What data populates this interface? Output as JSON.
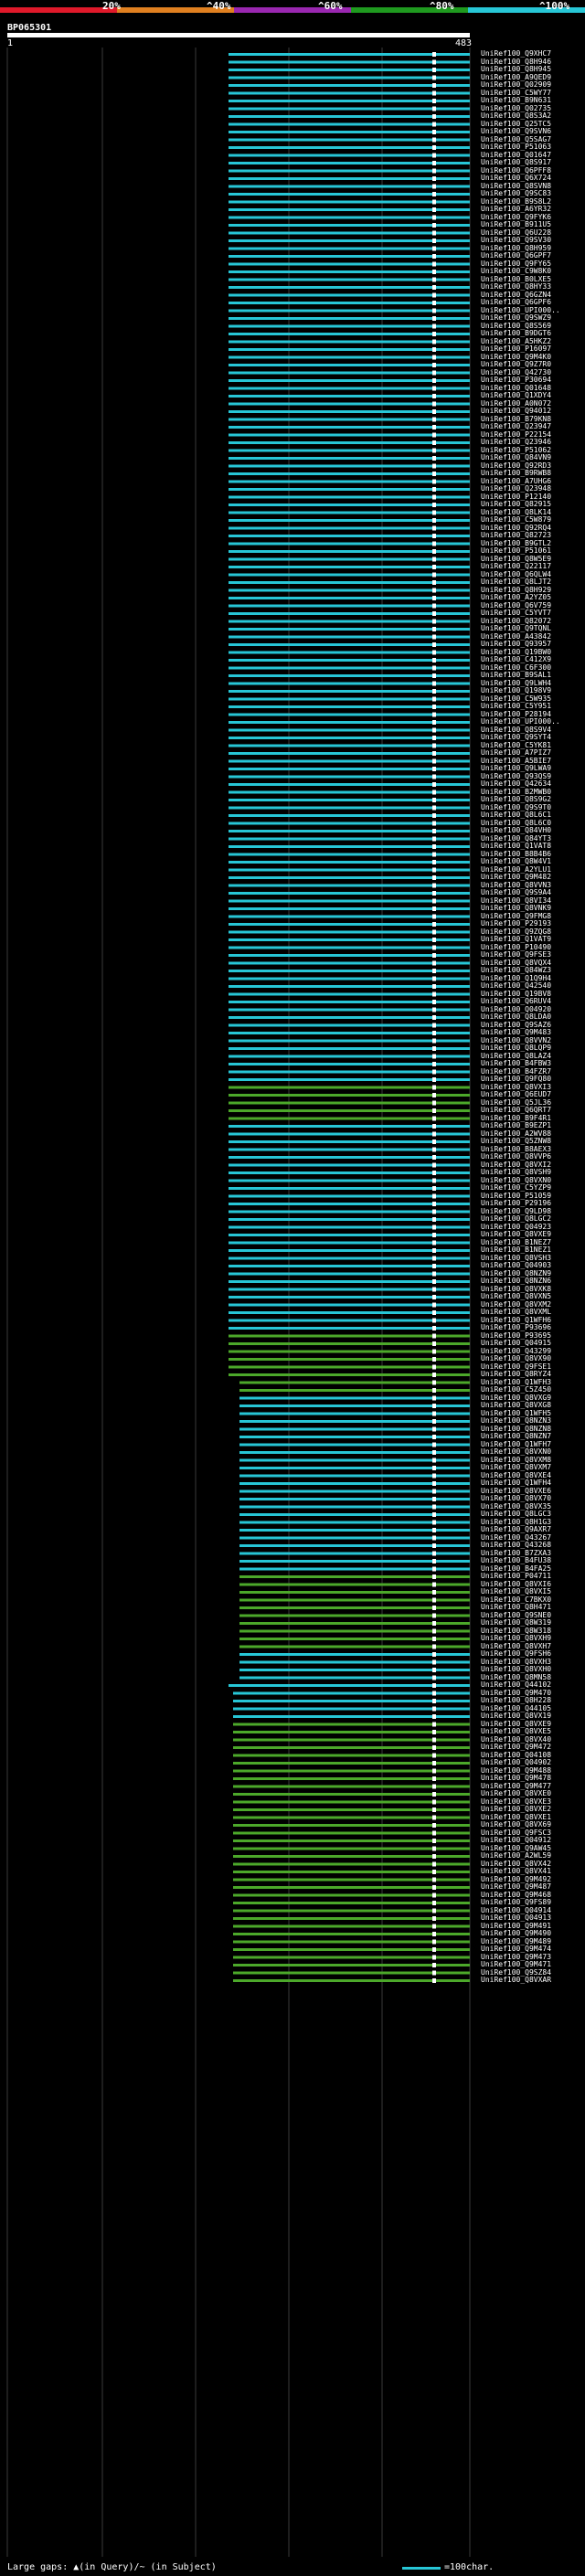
{
  "colors": {
    "scale": [
      "#e0192a",
      "#e08020",
      "#9a27b0",
      "#1f9a1f",
      "#27c6d6"
    ],
    "hit_cyan": "#27c6d6",
    "hit_green": "#4ca82a",
    "query_bar": "#ffffff",
    "gridline": "#3a3a3a"
  },
  "scale": {
    "labels": [
      "20%",
      "^40%",
      "^60%",
      "^80%",
      "^100%"
    ]
  },
  "query": {
    "name": "BP065301",
    "start": "1",
    "end": "483"
  },
  "footer": {
    "legend_text": "Large gaps: ▲(in Query)/~ (in Subject)",
    "scale_text": "=100char."
  },
  "hits": [
    "UniRef100_Q9XHC7",
    "UniRef100_Q8H946",
    "UniRef100_Q8H945",
    "UniRef100_A9QED9",
    "UniRef100_Q02909",
    "UniRef100_C5WY77",
    "UniRef100_B9N631",
    "UniRef100_Q02735",
    "UniRef100_Q8S3A2",
    "UniRef100_Q25TC5",
    "UniRef100_Q9SVN6",
    "UniRef100_Q5SAG7",
    "UniRef100_P51063",
    "UniRef100_Q01647",
    "UniRef100_Q8S917",
    "UniRef100_Q6PFF8",
    "UniRef100_Q6X724",
    "UniRef100_Q8SVN8",
    "UniRef100_Q9SC83",
    "UniRef100_B9S8L2",
    "UniRef100_A6YR32",
    "UniRef100_Q9FYK6",
    "UniRef100_B911U5",
    "UniRef100_Q6U228",
    "UniRef100_Q9SV30",
    "UniRef100_Q8H959",
    "UniRef100_Q6GPF7",
    "UniRef100_Q9FY65",
    "UniRef100_C9W8K0",
    "UniRef100_B0LXE5",
    "UniRef100_Q8HY33",
    "UniRef100_Q6GZN4",
    "UniRef100_Q6GPF6",
    "UniRef100_UPI000..",
    "UniRef100_Q9SWZ9",
    "UniRef100_Q8S569",
    "UniRef100_B9DGT6",
    "UniRef100_A5HKZ2",
    "UniRef100_P16097",
    "UniRef100_Q9M4K0",
    "UniRef100_Q9Z7R0",
    "UniRef100_Q42730",
    "UniRef100_P30694",
    "UniRef100_Q01648",
    "UniRef100_Q1XDY4",
    "UniRef100_A0N072",
    "UniRef100_Q94012",
    "UniRef100_B79KN8",
    "UniRef100_Q23947",
    "UniRef100_P22154",
    "UniRef100_Q23946",
    "UniRef100_P51062",
    "UniRef100_Q84VN9",
    "UniRef100_Q92RD3",
    "UniRef100_B9RWB8",
    "UniRef100_A7UHG6",
    "UniRef100_Q23948",
    "UniRef100_P12140",
    "UniRef100_Q82915",
    "UniRef100_Q8LK14",
    "UniRef100_C5W879",
    "UniRef100_Q92RQ4",
    "UniRef100_Q82723",
    "UniRef100_B9GTL2",
    "UniRef100_P51061",
    "UniRef100_Q8W5E9",
    "UniRef100_Q22117",
    "UniRef100_Q6QLW4",
    "UniRef100_Q8LJT2",
    "UniRef100_Q8H929",
    "UniRef100_A2YZ05",
    "UniRef100_Q6V759",
    "UniRef100_C5YVT7",
    "UniRef100_Q82072",
    "UniRef100_Q9TQNL",
    "UniRef100_A43842",
    "UniRef100_Q93957",
    "UniRef100_Q19BW0",
    "UniRef100_C412X9",
    "UniRef100_C6F300",
    "UniRef100_B9SAL1",
    "UniRef100_Q9LWH4",
    "UniRef100_Q198V9",
    "UniRef100_C5W935",
    "UniRef100_C5Y951",
    "UniRef100_P28194",
    "UniRef100_UPI000..",
    "UniRef100_Q8S9V4",
    "UniRef100_Q9SYT4",
    "UniRef100_C5YK81",
    "UniRef100_A7PIZ7",
    "UniRef100_A5BIE7",
    "UniRef100_Q9LWA9",
    "UniRef100_Q93QS9",
    "UniRef100_Q42634",
    "UniRef100_B2MWB0",
    "UniRef100_Q8S9G2",
    "UniRef100_Q9S9T0",
    "UniRef100_Q8L6C1",
    "UniRef100_Q8L6C0",
    "UniRef100_Q84VH0",
    "UniRef100_Q84YT3",
    "UniRef100_Q1VAT8",
    "UniRef100_B8B4B6",
    "UniRef100_Q8W4V1",
    "UniRef100_A2YLU1",
    "UniRef100_Q9M482",
    "UniRef100_Q8VVN3",
    "UniRef100_Q9S9A4",
    "UniRef100_Q8VI34",
    "UniRef100_Q8VNK9",
    "UniRef100_Q9FMG8",
    "UniRef100_P29193",
    "UniRef100_Q9ZQG8",
    "UniRef100_Q1VAT9",
    "UniRef100_P10490",
    "UniRef100_Q9FSE3",
    "UniRef100_Q8VQX4",
    "UniRef100_Q84WZ3",
    "UniRef100_Q1Q9H4",
    "UniRef100_Q42540",
    "UniRef100_Q19BV8",
    "UniRef100_Q6RUV4",
    "UniRef100_Q04920",
    "UniRef100_Q8LDA0",
    "UniRef100_Q9SAZ6",
    "UniRef100_Q9M483",
    "UniRef100_Q8VVN2",
    "UniRef100_Q8LQP9",
    "UniRef100_Q8LAZ4",
    "UniRef100_B4FBW3",
    "UniRef100_B4FZR7",
    "UniRef100_Q9FQ80",
    "UniRef100_Q8VXI3",
    "UniRef100_Q6EUD7",
    "UniRef100_Q5JL36",
    "UniRef100_Q6QRT7",
    "UniRef100_B9F4R1",
    "UniRef100_B9EZP1",
    "UniRef100_A2WV88",
    "UniRef100_Q5ZNW8",
    "UniRef100_B8AEX3",
    "UniRef100_Q8VVP6",
    "UniRef100_Q8VXI2",
    "UniRef100_Q8VSH9",
    "UniRef100_Q8VXN0",
    "UniRef100_C5YZP9",
    "UniRef100_P51059",
    "UniRef100_P29196",
    "UniRef100_Q9LD98",
    "UniRef100_Q8LGC2",
    "UniRef100_Q04923",
    "UniRef100_Q8VXE9",
    "UniRef100_B1NEZ7",
    "UniRef100_B1NEZ1",
    "UniRef100_Q8VSH3",
    "UniRef100_Q04903",
    "UniRef100_Q8NZN9",
    "UniRef100_Q8NZN6",
    "UniRef100_Q8VXK8",
    "UniRef100_Q8VXN5",
    "UniRef100_Q8VXM2",
    "UniRef100_Q8VXML",
    "UniRef100_Q1WFH6",
    "UniRef100_P93696",
    "UniRef100_P93695",
    "UniRef100_Q04915",
    "UniRef100_Q43299",
    "UniRef100_Q8VX90",
    "UniRef100_Q9FSE1",
    "UniRef100_Q8RYZ4",
    "UniRef100_Q1WFH3",
    "UniRef100_C5Z450",
    "UniRef100_Q8VXG9",
    "UniRef100_Q8VXG8",
    "UniRef100_Q1WFH5",
    "UniRef100_Q8NZN3",
    "UniRef100_Q8NZN8",
    "UniRef100_Q8NZN7",
    "UniRef100_Q1WFH7",
    "UniRef100_Q8VXN0",
    "UniRef100_Q8VXM8",
    "UniRef100_Q8VXM7",
    "UniRef100_Q8VXE4",
    "UniRef100_Q1WFH4",
    "UniRef100_Q8VXE6",
    "UniRef100_Q8VX70",
    "UniRef100_Q8VX35",
    "UniRef100_Q8LGC3",
    "UniRef100_Q8H1G3",
    "UniRef100_Q9AXR7",
    "UniRef100_Q43267",
    "UniRef100_Q43268",
    "UniRef100_B7ZXA3",
    "UniRef100_B4FU38",
    "UniRef100_B4FA25",
    "UniRef100_P04711",
    "UniRef100_Q8VXI6",
    "UniRef100_Q8VXI5",
    "UniRef100_C7BKX0",
    "UniRef100_Q8H471",
    "UniRef100_Q9SNE0",
    "UniRef100_Q8W319",
    "UniRef100_Q8W318",
    "UniRef100_Q8VXH9",
    "UniRef100_Q8VXH7",
    "UniRef100_Q9FSH6",
    "UniRef100_Q8VXH3",
    "UniRef100_Q8VXH0",
    "UniRef100_Q8MN58",
    "UniRef100_Q44102",
    "UniRef100_Q9M470",
    "UniRef100_Q8H228",
    "UniRef100_Q44105",
    "UniRef100_Q8VX19",
    "UniRef100_Q8VXE9",
    "UniRef100_Q8VXE5",
    "UniRef100_Q8VX40",
    "UniRef100_Q9M472",
    "UniRef100_Q04108",
    "UniRef100_Q04902",
    "UniRef100_Q9M488",
    "UniRef100_Q9M478",
    "UniRef100_Q9M477",
    "UniRef100_Q8VXE0",
    "UniRef100_Q8VXE3",
    "UniRef100_Q8VXE2",
    "UniRef100_Q8VXE1",
    "UniRef100_Q8VX69",
    "UniRef100_Q9FSC3",
    "UniRef100_Q04912",
    "UniRef100_Q9AW45",
    "UniRef100_A2WL59",
    "UniRef100_Q8VX42",
    "UniRef100_Q8VX41",
    "UniRef100_Q9M492",
    "UniRef100_Q9M487",
    "UniRef100_Q9M468",
    "UniRef100_Q9FS89",
    "UniRef100_Q04914",
    "UniRef100_Q04913",
    "UniRef100_Q9M491",
    "UniRef100_Q9M490",
    "UniRef100_Q9M489",
    "UniRef100_Q9M474",
    "UniRef100_Q9M473",
    "UniRef100_Q9M471",
    "UniRef100_Q9SZ84",
    "UniRef100_Q8VXAR"
  ]
}
